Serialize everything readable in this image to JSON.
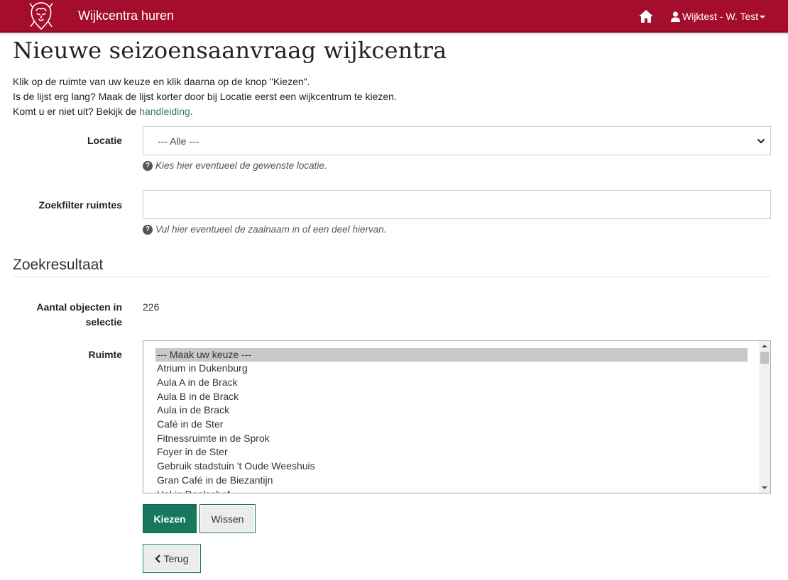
{
  "navbar": {
    "brand": "Wijkcentra huren",
    "user": "Wijktest - W. Test",
    "logo_icon": "lion-crest-logo",
    "home_icon": "home-icon",
    "user_icon": "user-icon",
    "color": "#a50d2c"
  },
  "page": {
    "title": "Nieuwe seizoensaanvraag wijkcentra",
    "intro_line1": "Klik op de ruimte van uw keuze en klik daarna op de knop \"Kiezen\".",
    "intro_line2": "Is de lijst erg lang? Maak de lijst korter door bij Locatie eerst een wijkcentrum te kiezen.",
    "intro_line3_prefix": "Komt u er niet uit? Bekijk de ",
    "intro_line3_link": "handleiding",
    "intro_line3_suffix": "."
  },
  "form": {
    "locatie_label": "Locatie",
    "locatie_value": "--- Alle ---",
    "locatie_help": "Kies hier eventueel de gewenste locatie.",
    "zoekfilter_label": "Zoekfilter ruimtes",
    "zoekfilter_value": "",
    "zoekfilter_help": "Vul hier eventueel de zaalnaam in of een deel hiervan."
  },
  "results": {
    "heading": "Zoekresultaat",
    "count_label": "Aantal objecten in selectie",
    "count_label_line1": "Aantal objecten in",
    "count_label_line2": "selectie",
    "count_value": "226",
    "ruimte_label": "Ruimte",
    "options": [
      "--- Maak uw keuze ---",
      "Atrium in Dukenburg",
      "Aula A in de Brack",
      "Aula B in de Brack",
      "Aula in de Brack",
      "Café in de Ster",
      "Fitnessruimte in de Sprok",
      "Foyer in de Ster",
      "Gebruik stadstuin 't Oude Weeshuis",
      "Gran Café in de Biezantijn",
      "Hal in Daalsehof"
    ],
    "selected_index": 0
  },
  "buttons": {
    "kiezen": "Kiezen",
    "wissen": "Wissen",
    "terug": "Terug",
    "primary_color": "#17785f"
  }
}
